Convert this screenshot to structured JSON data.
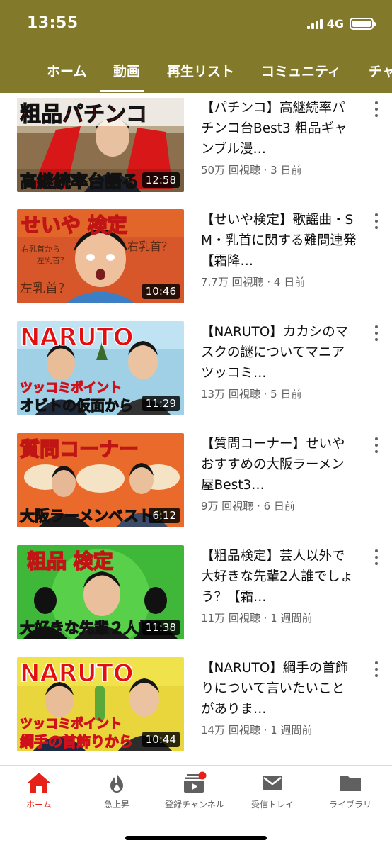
{
  "status_bar": {
    "time": "13:55",
    "network": "4G"
  },
  "tabs": [
    {
      "label": "ホーム"
    },
    {
      "label": "動画",
      "active": true
    },
    {
      "label": "再生リスト"
    },
    {
      "label": "コミュニティ"
    },
    {
      "label": "チャ"
    }
  ],
  "videos": [
    {
      "title": "【パチンコ】高継続率パチンコ台Best3 粗品ギャンブル漫…",
      "stats": "50万 回視聴 · 3 日前",
      "duration": "12:58",
      "thumb_text": [
        "粗品パチンコ",
        "高継続率台語る"
      ]
    },
    {
      "title": "【せいや検定】歌謡曲・SM・乳首に関する難問連発【霜降…",
      "stats": "7.7万 回視聴 · 4 日前",
      "duration": "10:46",
      "thumb_text": [
        "せいや 検定",
        "右乳首から",
        "左乳首？",
        "右乳首？",
        "左乳首？"
      ]
    },
    {
      "title": "【NARUTO】カカシのマスクの謎についてマニアツッコミ…",
      "stats": "13万 回視聴 · 5 日前",
      "duration": "11:29",
      "thumb_text": [
        "NARUTO",
        "ツッコミポイント",
        "オビトの仮面から"
      ]
    },
    {
      "title": "【質問コーナー】せいやおすすめの大阪ラーメン屋Best3…",
      "stats": "9万 回視聴 · 6 日前",
      "duration": "6:12",
      "thumb_text": [
        "質問コーナー",
        "大阪ラーメンベスト3"
      ]
    },
    {
      "title": "【粗品検定】芸人以外で大好きな先輩2人誰でしょう？【霜…",
      "stats": "11万 回視聴 · 1 週間前",
      "duration": "11:38",
      "thumb_text": [
        "粗品 検定",
        "大好きな先輩２人誰？"
      ]
    },
    {
      "title": "【NARUTO】綱手の首飾りについて言いたいことがありま…",
      "stats": "14万 回視聴 · 1 週間前",
      "duration": "10:44",
      "thumb_text": [
        "NARUTO",
        "ツッコミポイント",
        "綱手の首飾りから"
      ]
    }
  ],
  "bottom_nav": [
    {
      "label": "ホーム",
      "icon": "home-icon",
      "active": true
    },
    {
      "label": "急上昇",
      "icon": "flame-icon"
    },
    {
      "label": "登録チャンネル",
      "icon": "subscriptions-icon"
    },
    {
      "label": "受信トレイ",
      "icon": "inbox-icon"
    },
    {
      "label": "ライブラリ",
      "icon": "folder-icon"
    }
  ],
  "colors": {
    "header": "#827a2a",
    "accent": "#e62117",
    "title_text": "#0f0f0f",
    "meta_text": "#606060"
  }
}
